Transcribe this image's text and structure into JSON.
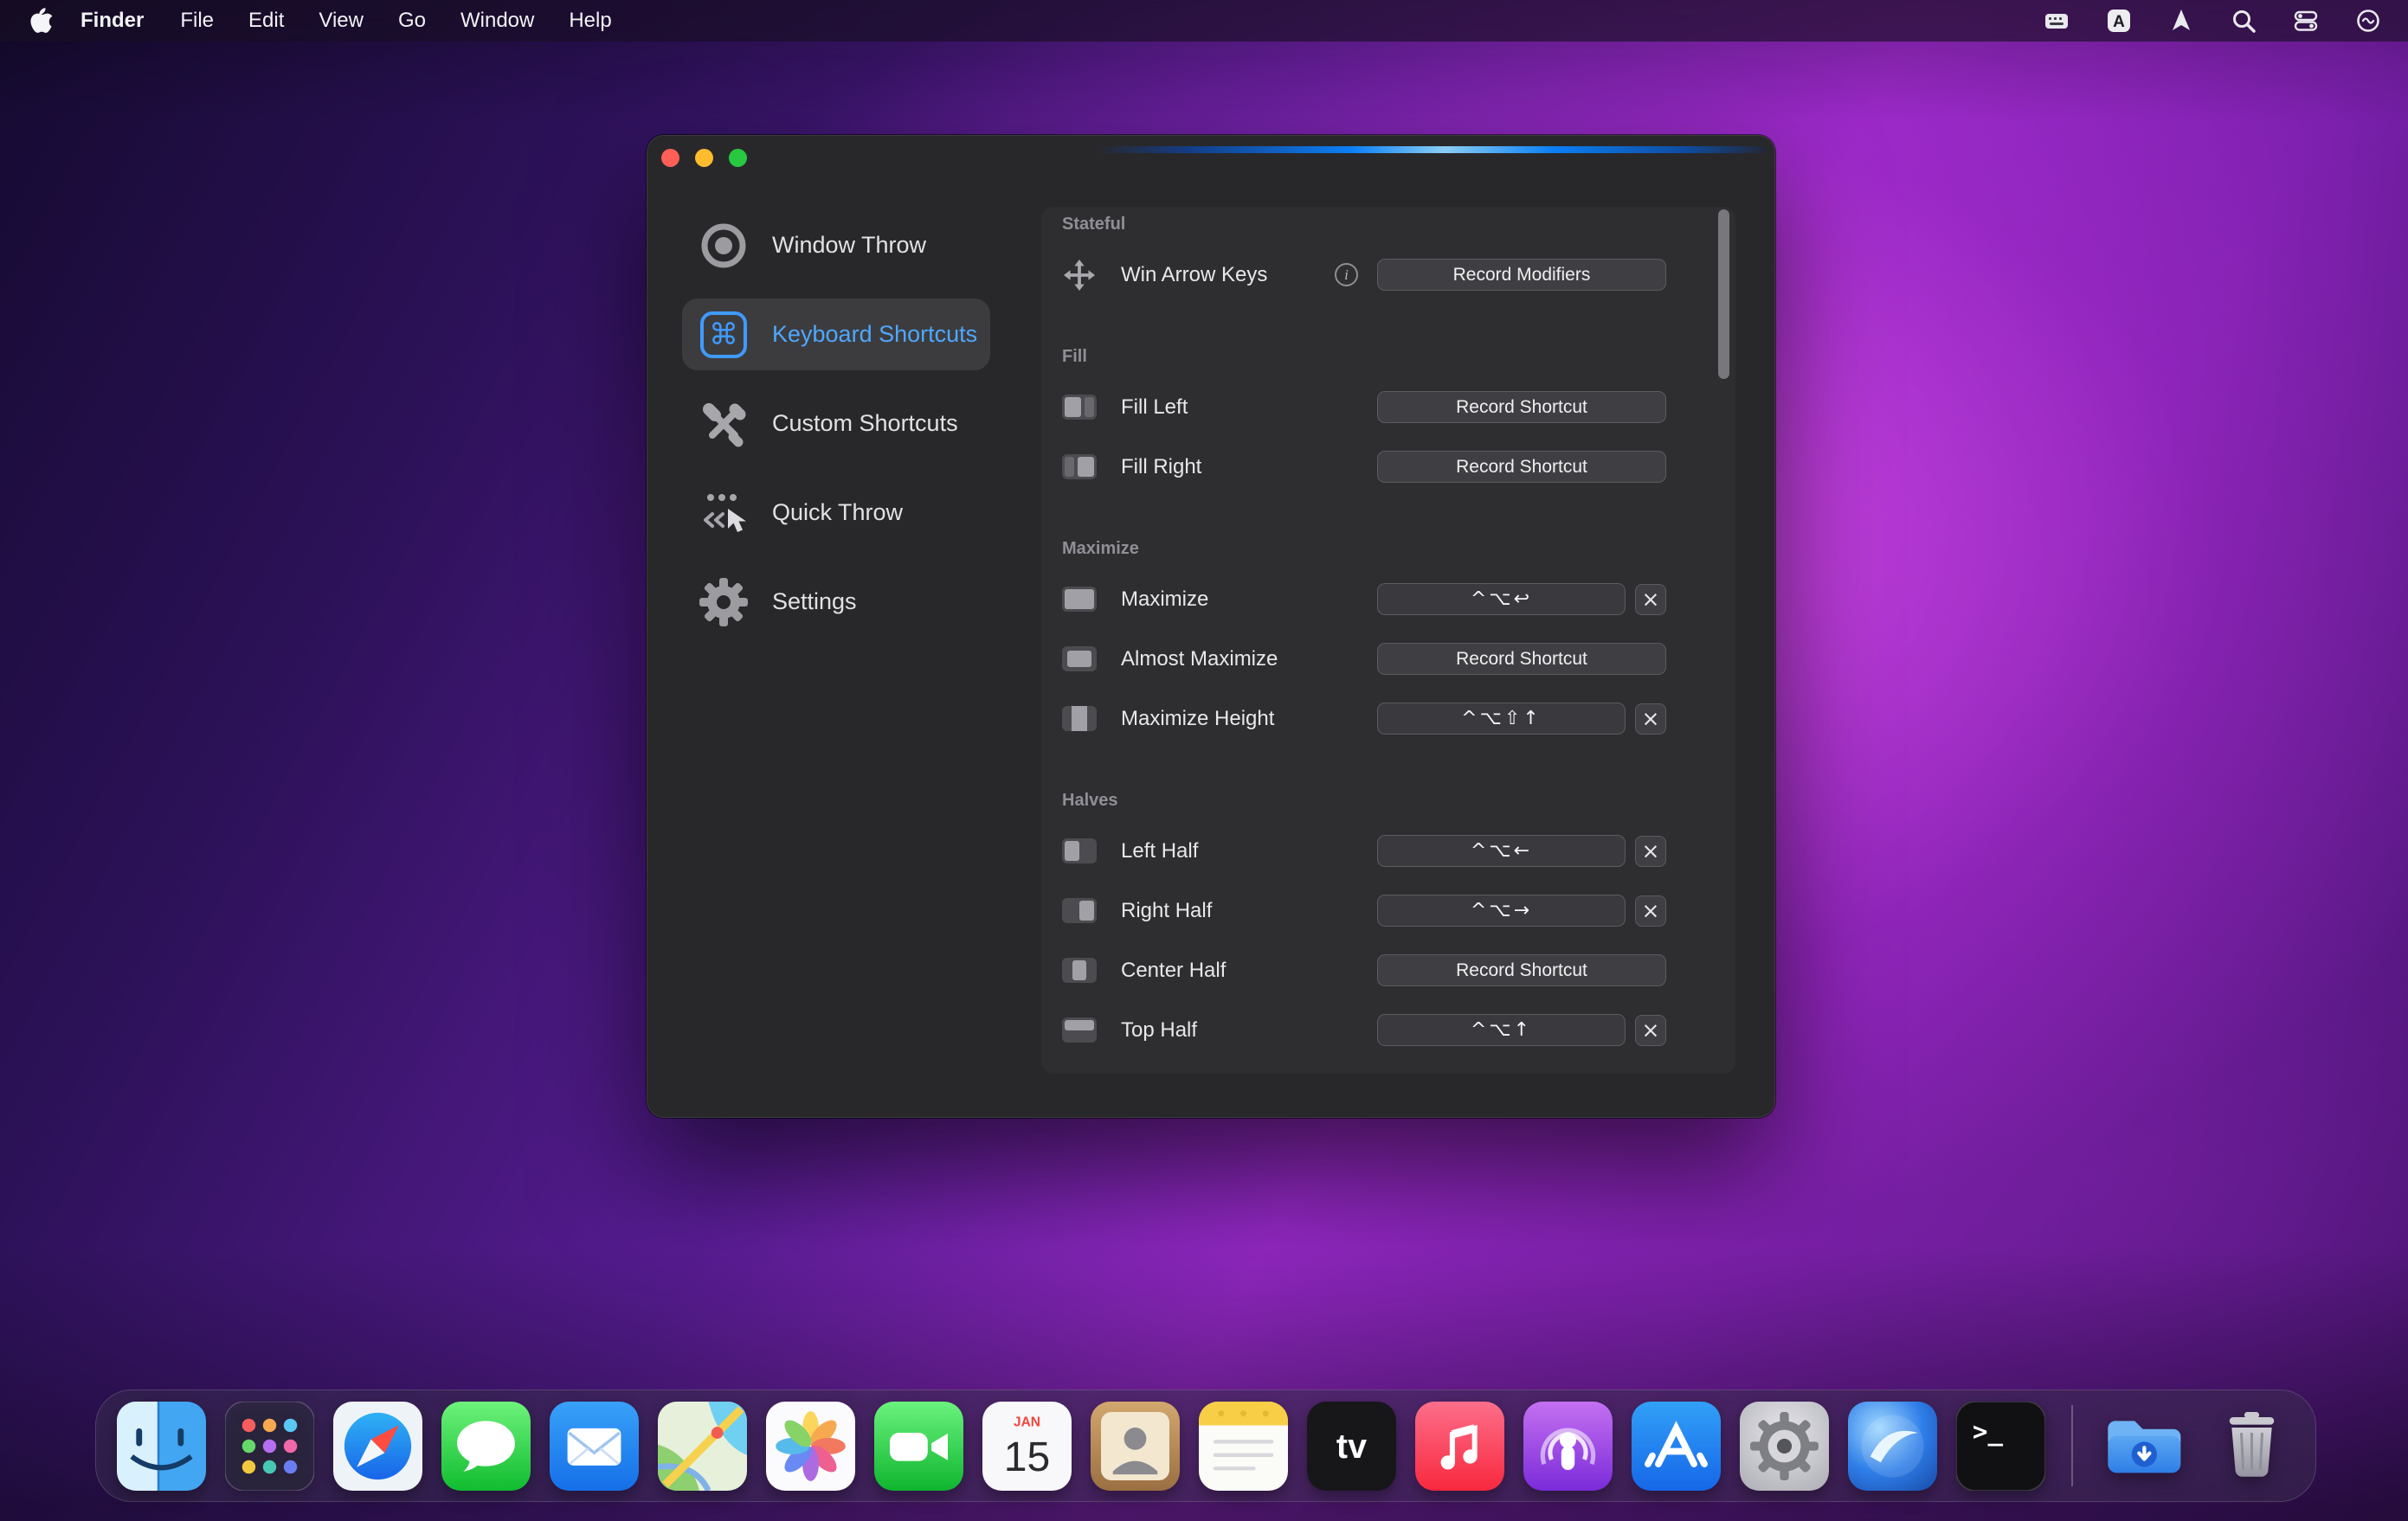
{
  "menu_bar": {
    "app_name": "Finder",
    "menus": [
      "File",
      "Edit",
      "View",
      "Go",
      "Window",
      "Help"
    ],
    "input_source_label": "A",
    "status_icons": [
      "keyboard-icon",
      "input-source-icon",
      "location-icon",
      "spotlight-icon",
      "control-center-icon",
      "siri-icon"
    ]
  },
  "window": {
    "accent_color": "#0a84ff",
    "sidebar": {
      "command_glyph": "⌘",
      "items": [
        {
          "label": "Window Throw",
          "icon": "target-icon",
          "selected": false
        },
        {
          "label": "Keyboard Shortcuts",
          "icon": "command-icon",
          "selected": true
        },
        {
          "label": "Custom Shortcuts",
          "icon": "tools-icon",
          "selected": false
        },
        {
          "label": "Quick Throw",
          "icon": "cursor-icon",
          "selected": false
        },
        {
          "label": "Settings",
          "icon": "gear-icon",
          "selected": false
        }
      ]
    },
    "content": {
      "info_glyph": "i",
      "clear_glyph": "×",
      "sections": [
        {
          "title": "Stateful",
          "rows": [
            {
              "label": "Win Arrow Keys",
              "icon": "move-arrows-icon",
              "info": true,
              "control": "button",
              "button_label": "Record Modifiers"
            }
          ]
        },
        {
          "title": "Fill",
          "rows": [
            {
              "label": "Fill Left",
              "icon": "fill-left-icon",
              "control": "button",
              "button_label": "Record Shortcut"
            },
            {
              "label": "Fill Right",
              "icon": "fill-right-icon",
              "control": "button",
              "button_label": "Record Shortcut"
            }
          ]
        },
        {
          "title": "Maximize",
          "rows": [
            {
              "label": "Maximize",
              "icon": "maximize-icon",
              "control": "shortcut",
              "shortcut": "^⌥↩"
            },
            {
              "label": "Almost Maximize",
              "icon": "almost-maximize-icon",
              "control": "button",
              "button_label": "Record Shortcut"
            },
            {
              "label": "Maximize Height",
              "icon": "maximize-height-icon",
              "control": "shortcut",
              "shortcut": "^⌥⇧↑"
            }
          ]
        },
        {
          "title": "Halves",
          "rows": [
            {
              "label": "Left Half",
              "icon": "left-half-icon",
              "control": "shortcut",
              "shortcut": "^⌥←"
            },
            {
              "label": "Right Half",
              "icon": "right-half-icon",
              "control": "shortcut",
              "shortcut": "^⌥→"
            },
            {
              "label": "Center Half",
              "icon": "center-half-icon",
              "control": "button",
              "button_label": "Record Shortcut"
            },
            {
              "label": "Top Half",
              "icon": "top-half-icon",
              "control": "shortcut",
              "shortcut": "^⌥↑"
            }
          ]
        }
      ]
    }
  },
  "dock": {
    "items": [
      "finder",
      "launchpad",
      "safari",
      "messages",
      "mail",
      "maps",
      "photos",
      "facetime",
      "calendar",
      "contacts",
      "notes",
      "apple-tv",
      "music",
      "podcasts",
      "app-store",
      "system-preferences",
      "window-throw-app",
      "terminal",
      "downloads",
      "trash"
    ],
    "calendar": {
      "month": "JAN",
      "day": "15"
    },
    "appletv_label": "tv",
    "terminal_prompt": ">_"
  },
  "colors": {
    "accent": "#0a84ff",
    "selected_text": "#4fa8ff",
    "window_bg": "#28282b",
    "panel_bg": "#2e2e31"
  }
}
